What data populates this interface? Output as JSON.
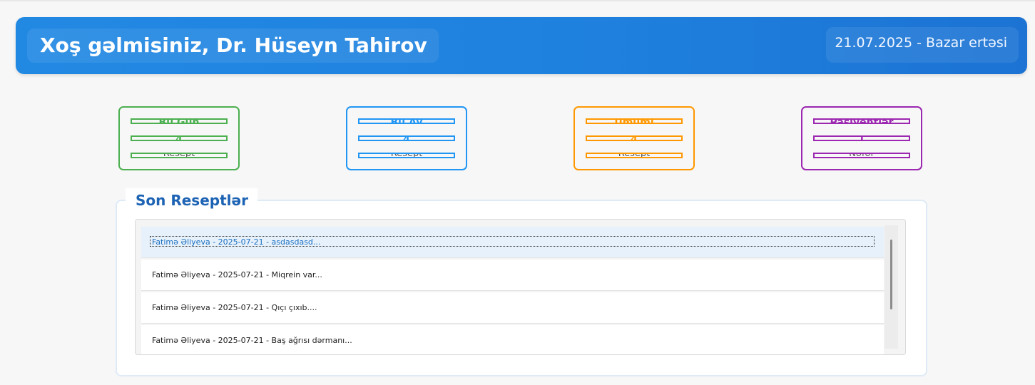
{
  "header": {
    "welcome": "Xoş gəlmisiniz, Dr. Hüseyn Tahirov",
    "date": "21.07.2025 - Bazar ertəsi",
    "background_color": "#1f81de"
  },
  "stats": [
    {
      "title": "Bu Gün",
      "count": "4",
      "unit": "Resept",
      "color": "#4caf50"
    },
    {
      "title": "Bu Ay",
      "count": "4",
      "unit": "Resept",
      "color": "#2196f3"
    },
    {
      "title": "Ümumi",
      "count": "4",
      "unit": "Resept",
      "color": "#ff9800"
    },
    {
      "title": "Pasiyentlər",
      "count": "1",
      "unit": "Nəfər",
      "color": "#9c27b0"
    }
  ],
  "recent": {
    "title": "Son Reseptlər",
    "items": [
      "Fatimə Əliyeva - 2025-07-21 - asdasdasd...",
      "Fatimə Əliyeva - 2025-07-21 - Miqrein var...",
      "Fatimə Əliyeva - 2025-07-21 - Qıçı çıxıb....",
      "Fatimə Əliyeva - 2025-07-21 - Baş ağrısı dərmanı..."
    ],
    "selected_index": 0
  }
}
